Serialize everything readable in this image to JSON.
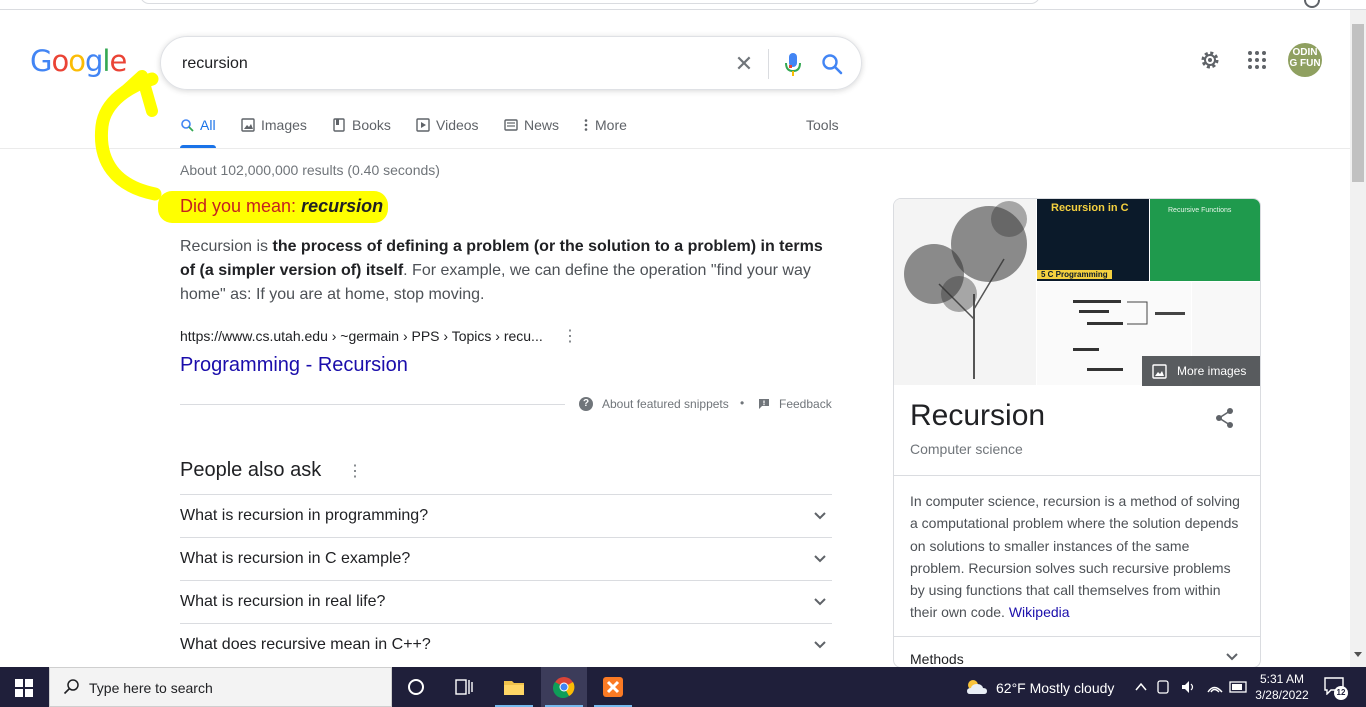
{
  "search": {
    "query": "recursion",
    "clear_icon": "close-icon",
    "mic_icon": "mic-icon",
    "search_icon": "search-icon"
  },
  "logo": {
    "letters": [
      "G",
      "o",
      "o",
      "g",
      "l",
      "e"
    ]
  },
  "header": {
    "settings_icon": "gear-icon",
    "apps_icon": "apps-grid-icon",
    "avatar_text": "ODIN\nG FUN"
  },
  "tabs": [
    {
      "label": "All",
      "icon": "search-icon",
      "active": true
    },
    {
      "label": "Images",
      "icon": "image-icon"
    },
    {
      "label": "Books",
      "icon": "book-icon"
    },
    {
      "label": "Videos",
      "icon": "play-icon"
    },
    {
      "label": "News",
      "icon": "news-icon"
    },
    {
      "label": "More",
      "icon": "more-vert-icon"
    }
  ],
  "tools_label": "Tools",
  "stats": "About 102,000,000 results (0.40 seconds)",
  "did_you_mean": {
    "prefix": "Did you mean:",
    "suggestion": "recursion"
  },
  "snippet": {
    "p1": "Recursion is ",
    "bold": "the process of defining a problem (or the solution to a problem) in terms of (a simpler version of) itself",
    "p2": ". For example, we can define the operation \"find your way home\" as: If you are at home, stop moving."
  },
  "result": {
    "cite": "https://www.cs.utah.edu › ~germain › PPS › Topics › recu...",
    "title": "Programming - Recursion"
  },
  "feedback": {
    "about": "About featured snippets",
    "separator": "•",
    "feedback": "Feedback"
  },
  "people_also_ask": {
    "title": "People also ask",
    "questions": [
      "What is recursion in programming?",
      "What is recursion in C example?",
      "What is recursion in real life?",
      "What does recursive mean in C++?"
    ]
  },
  "knowledge_panel": {
    "img2_title": "Recursion in C",
    "img2_badge": "5 C Programming",
    "img3_title": "Recursive Functions",
    "more_images": "More images",
    "title": "Recursion",
    "subtitle": "Computer science",
    "description": "In computer science, recursion is a method of solving a computational problem where the solution depends on solutions to smaller instances of the same problem. Recursion solves such recursive problems by using functions that call themselves from within their own code. ",
    "source": "Wikipedia",
    "methods": "Methods"
  },
  "taskbar": {
    "search_placeholder": "Type here to search",
    "weather": "62°F  Mostly cloudy",
    "time": "5:31 AM",
    "date": "3/28/2022",
    "notifications": "12"
  },
  "colors": {
    "google_blue": "#1a73e8",
    "link": "#1a0dab",
    "highlight": "#ffff00",
    "did_you_mean": "#c5221f"
  }
}
